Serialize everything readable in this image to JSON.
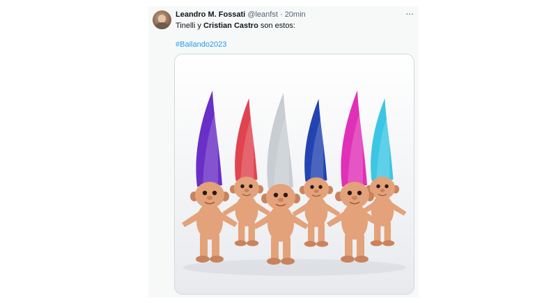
{
  "tweet": {
    "author_name": "Leandro M. Fossati",
    "handle": "@leanfst",
    "separator": "·",
    "time": "20min",
    "more_icon": "more-horizontal-icon",
    "text_before": "Tinelli y ",
    "text_bold": "Cristian Castro",
    "text_after": " son estos:",
    "hashtag": "#Bailando2023",
    "avatar_icon": "user-avatar",
    "media_trolls": [
      {
        "hair_color": "#6a2fc6",
        "row": "front"
      },
      {
        "hair_color": "#e04450",
        "row": "back"
      },
      {
        "hair_color": "#c8cdd2",
        "row": "front"
      },
      {
        "hair_color": "#2344b0",
        "row": "back"
      },
      {
        "hair_color": "#e030b8",
        "row": "front"
      },
      {
        "hair_color": "#3cc6e4",
        "row": "back"
      }
    ],
    "colors": {
      "text": "#0f1419",
      "secondary": "#536471",
      "link": "#1d9bf0",
      "card_bg": "#f7f9f9"
    }
  }
}
